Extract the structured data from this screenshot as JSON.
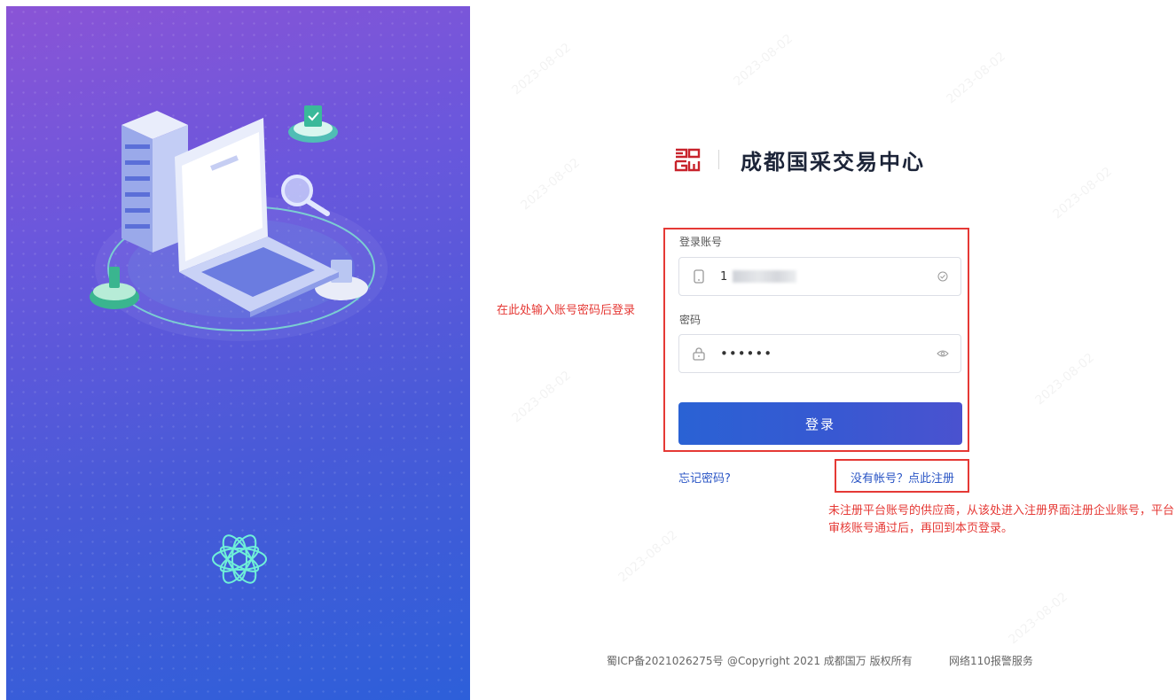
{
  "brand": {
    "title": "成都国采交易中心"
  },
  "annotations": {
    "left": "在此处输入账号密码后登录",
    "right": "未注册平台账号的供应商，从该处进入注册界面注册企业账号，平台审核账号通过后，再回到本页登录。"
  },
  "form": {
    "account_label": "登录账号",
    "account_value": "1",
    "password_label": "密码",
    "password_value": "••••••",
    "login_button": "登录",
    "forgot_link": "忘记密码?",
    "register_link": "没有帐号？点此注册"
  },
  "footer": {
    "icp": "蜀ICP备2021026275号",
    "copyright": "@Copyright 2021 成都国万 版权所有",
    "police": "网络110报警服务"
  },
  "colors": {
    "accent": "#2a62d4",
    "highlight": "#e53935",
    "hero_top": "#8a54d6",
    "hero_bottom": "#2d5fd9"
  }
}
